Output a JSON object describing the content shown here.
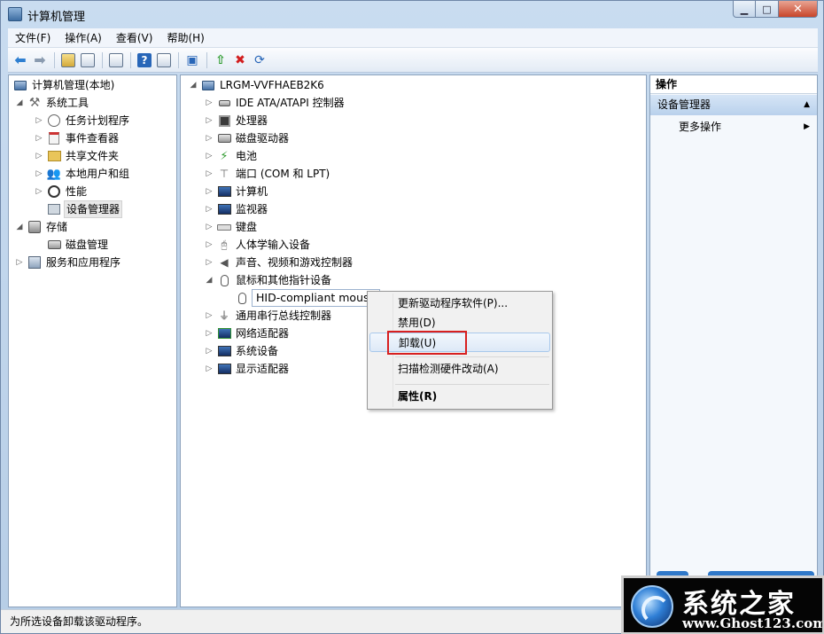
{
  "window": {
    "title": "计算机管理",
    "minimize_glyph": "▁",
    "maximize_glyph": "□",
    "close_glyph": "✕"
  },
  "menu": [
    "文件(F)",
    "操作(A)",
    "查看(V)",
    "帮助(H)"
  ],
  "toolbar": {
    "back_icon": "back-arrow-icon",
    "back_glyph": "⬅",
    "forward_icon": "forward-arrow-icon",
    "forward_glyph": "➡",
    "help_glyph": "?",
    "update_driver_glyph": "⇧",
    "uninstall_glyph": "✖",
    "scan_glyph": "⟳"
  },
  "left_tree": [
    {
      "label": "计算机管理(本地)",
      "toggle": "",
      "icon": "computer-management-icon"
    },
    {
      "label": "系统工具",
      "toggle": "◢",
      "icon": "system-tools-icon"
    },
    {
      "label": "任务计划程序",
      "toggle": "▷",
      "icon": "task-scheduler-icon"
    },
    {
      "label": "事件查看器",
      "toggle": "▷",
      "icon": "event-viewer-icon"
    },
    {
      "label": "共享文件夹",
      "toggle": "▷",
      "icon": "shared-folders-icon"
    },
    {
      "label": "本地用户和组",
      "toggle": "▷",
      "icon": "local-users-icon"
    },
    {
      "label": "性能",
      "toggle": "▷",
      "icon": "performance-icon"
    },
    {
      "label": "设备管理器",
      "toggle": "",
      "icon": "device-manager-icon"
    },
    {
      "label": "存储",
      "toggle": "◢",
      "icon": "storage-icon"
    },
    {
      "label": "磁盘管理",
      "toggle": "",
      "icon": "disk-management-icon"
    },
    {
      "label": "服务和应用程序",
      "toggle": "▷",
      "icon": "services-apps-icon"
    }
  ],
  "device_tree": {
    "root": "LRGM-VVFHAEB2K6",
    "root_toggle": "◢",
    "categories": [
      {
        "label": "IDE ATA/ATAPI 控制器",
        "toggle": "▷"
      },
      {
        "label": "处理器",
        "toggle": "▷"
      },
      {
        "label": "磁盘驱动器",
        "toggle": "▷"
      },
      {
        "label": "电池",
        "toggle": "▷"
      },
      {
        "label": "端口 (COM 和 LPT)",
        "toggle": "▷"
      },
      {
        "label": "计算机",
        "toggle": "▷"
      },
      {
        "label": "监视器",
        "toggle": "▷"
      },
      {
        "label": "键盘",
        "toggle": "▷"
      },
      {
        "label": "人体学输入设备",
        "toggle": "▷"
      },
      {
        "label": "声音、视频和游戏控制器",
        "toggle": "▷"
      },
      {
        "label": "鼠标和其他指针设备",
        "toggle": "◢"
      },
      {
        "label": "HID-compliant mouse",
        "toggle": ""
      },
      {
        "label": "通用串行总线控制器",
        "toggle": "▷"
      },
      {
        "label": "网络适配器",
        "toggle": "▷"
      },
      {
        "label": "系统设备",
        "toggle": "▷"
      },
      {
        "label": "显示适配器",
        "toggle": "▷"
      }
    ]
  },
  "context_menu": {
    "update_driver": "更新驱动程序软件(P)...",
    "disable": "禁用(D)",
    "uninstall": "卸载(U)",
    "scan": "扫描检测硬件改动(A)",
    "properties": "属性(R)"
  },
  "actions_pane": {
    "header": "操作",
    "group": "设备管理器",
    "group_arrow": "▲",
    "more_actions": "更多操作",
    "more_arrow": "▶"
  },
  "status": "为所选设备卸载该驱动程序。",
  "watermark": {
    "title": "系统之家",
    "url": "www.Ghost123.com"
  },
  "colors": {
    "accent": "#2866b8",
    "highlight_box": "#d82020",
    "title_gradient_top": "#c9dcf0"
  }
}
